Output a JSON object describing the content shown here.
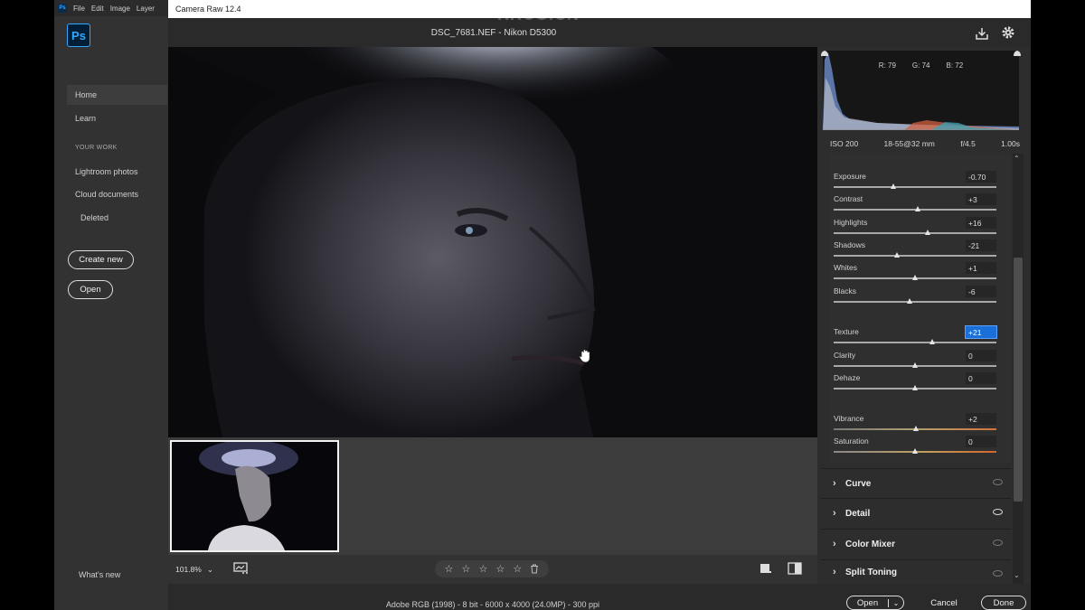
{
  "ps": {
    "menu": [
      "File",
      "Edit",
      "Image",
      "Layer"
    ],
    "logo": "Ps",
    "nav": {
      "home": "Home",
      "learn": "Learn",
      "your_work_heading": "YOUR WORK",
      "lightroom": "Lightroom photos",
      "cloud": "Cloud documents",
      "deleted": "Deleted",
      "whats_new": "What's new"
    },
    "buttons": {
      "create_new": "Create new",
      "open": "Open"
    }
  },
  "camera_raw": {
    "window_title": "Camera Raw 12.4",
    "file_title": "DSC_7681.NEF  -  Nikon D5300",
    "histogram": {
      "r": "R: 79",
      "g": "G: 74",
      "b": "B: 72"
    },
    "camera_info": {
      "iso": "ISO 200",
      "lens": "18-55@32 mm",
      "aperture": "f/4.5",
      "shutter": "1.00s"
    },
    "sliders": [
      {
        "label": "Exposure",
        "value": "-0.70",
        "pos": 0.37
      },
      {
        "label": "Contrast",
        "value": "+3",
        "pos": 0.52
      },
      {
        "label": "Highlights",
        "value": "+16",
        "pos": 0.58
      },
      {
        "label": "Shadows",
        "value": "-21",
        "pos": 0.39
      },
      {
        "label": "Whites",
        "value": "+1",
        "pos": 0.5
      },
      {
        "label": "Blacks",
        "value": "-6",
        "pos": 0.47
      },
      {
        "label": "Texture",
        "value": "+21",
        "pos": 0.61
      },
      {
        "label": "Clarity",
        "value": "0",
        "pos": 0.5
      },
      {
        "label": "Dehaze",
        "value": "0",
        "pos": 0.5
      },
      {
        "label": "Vibrance",
        "value": "+2",
        "pos": 0.51
      },
      {
        "label": "Saturation",
        "value": "0",
        "pos": 0.5
      }
    ],
    "sections": [
      {
        "label": "Curve",
        "visible": false
      },
      {
        "label": "Detail",
        "visible": true
      },
      {
        "label": "Color Mixer",
        "visible": false
      },
      {
        "label": "Split Toning",
        "visible": false
      }
    ],
    "zoom": "101.8%",
    "rating_stars": 0,
    "status_info": "Adobe RGB (1998) - 8 bit - 6000 x 4000 (24.0MP) - 300 ppi",
    "footer": {
      "open": "Open",
      "cancel": "Cancel",
      "done": "Done"
    }
  },
  "watermark": "RRCG.CN"
}
